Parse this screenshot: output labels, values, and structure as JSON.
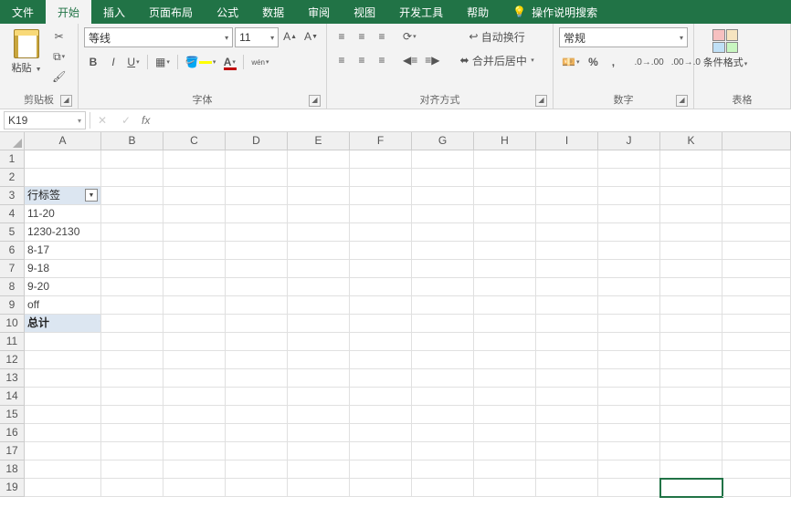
{
  "tabs": [
    "文件",
    "开始",
    "插入",
    "页面布局",
    "公式",
    "数据",
    "审阅",
    "视图",
    "开发工具",
    "帮助"
  ],
  "tell_me": "操作说明搜索",
  "clipboard": {
    "paste": "粘贴",
    "label": "剪贴板"
  },
  "font": {
    "name": "等线",
    "size": "11",
    "label": "字体",
    "ruby": "wén"
  },
  "align": {
    "wrap": "自动换行",
    "merge": "合并后居中",
    "label": "对齐方式"
  },
  "number": {
    "format": "常规",
    "label": "数字"
  },
  "styles": {
    "cf": "条件格式",
    "label": "表格"
  },
  "namebox": "K19",
  "fx": "fx",
  "cols": [
    "A",
    "B",
    "C",
    "D",
    "E",
    "F",
    "G",
    "H",
    "I",
    "J",
    "K"
  ],
  "rows": [
    "1",
    "2",
    "3",
    "4",
    "5",
    "6",
    "7",
    "8",
    "9",
    "10",
    "11",
    "12",
    "13",
    "14",
    "15",
    "16",
    "17",
    "18",
    "19"
  ],
  "pivot": {
    "header": "行标签",
    "items": [
      "11-20",
      "1230-2130",
      "8-17",
      "9-18",
      "9-20",
      "off"
    ],
    "total": "总计"
  },
  "active": {
    "row": 19,
    "col": "K"
  }
}
